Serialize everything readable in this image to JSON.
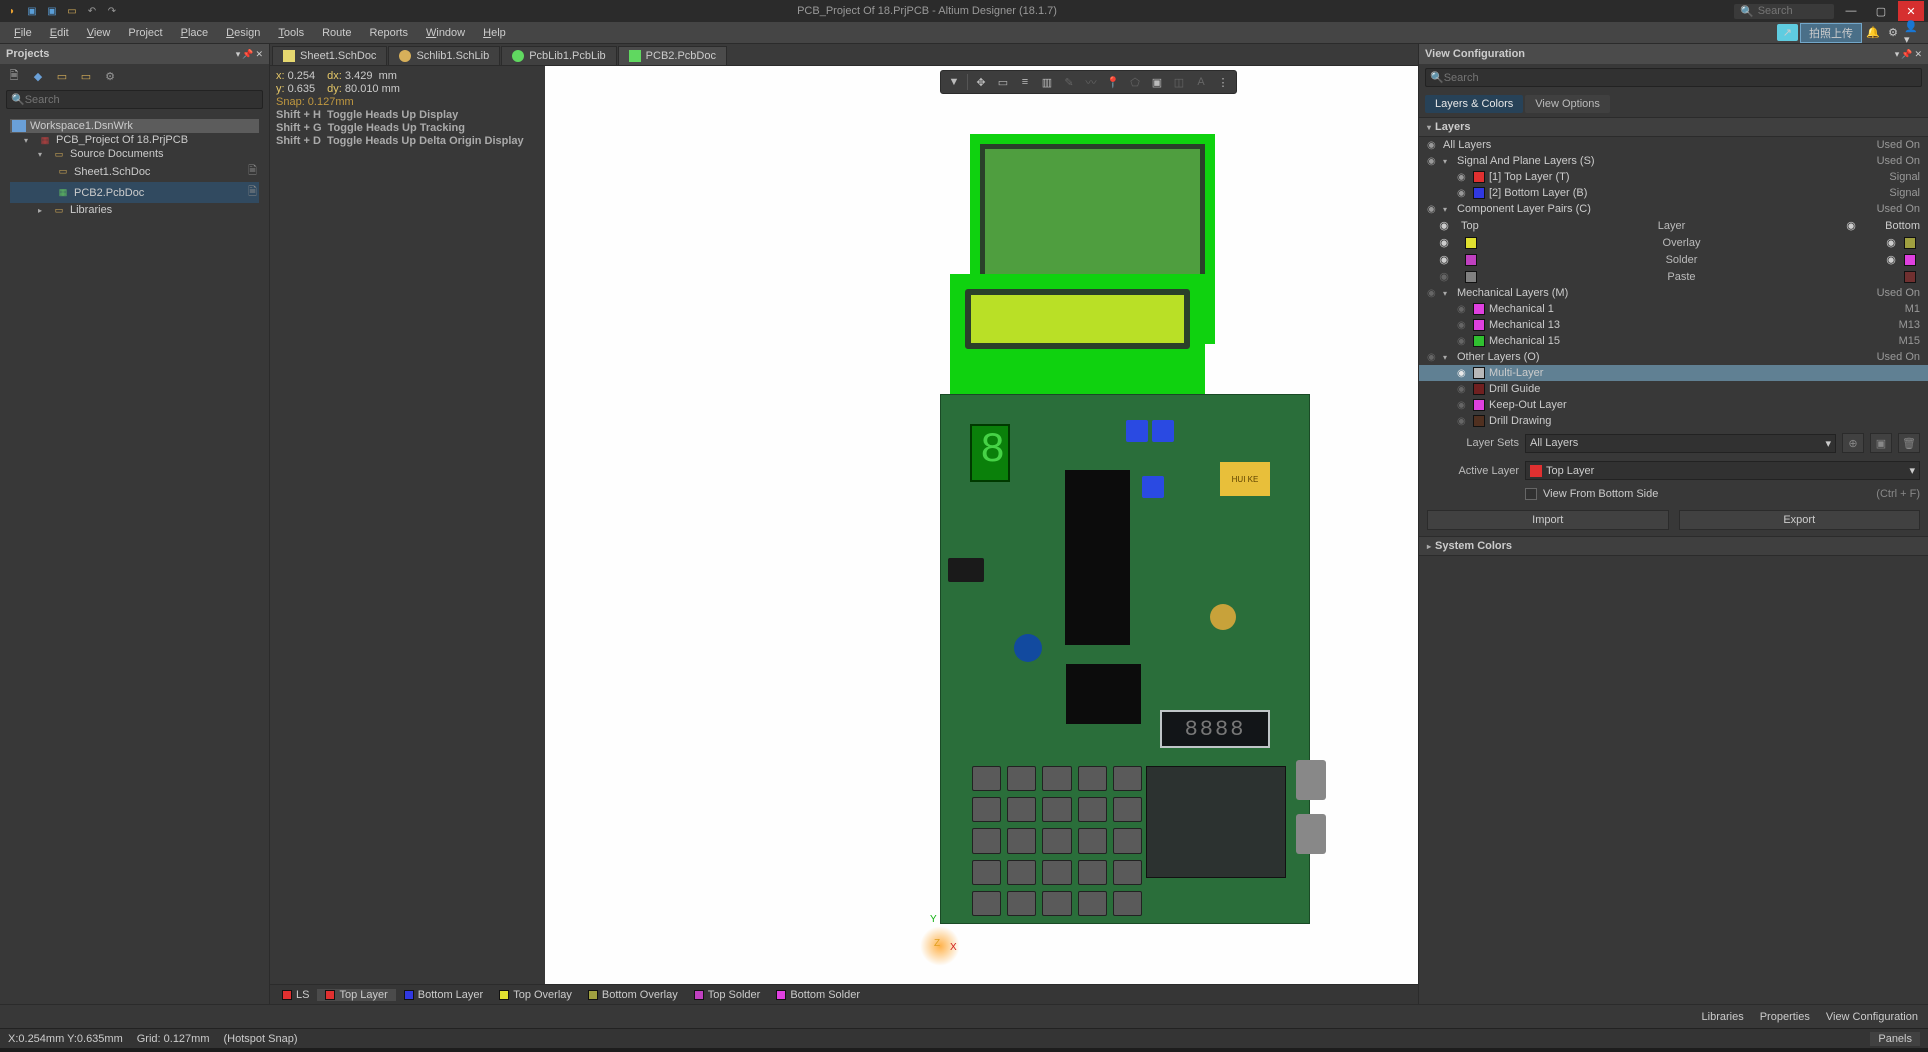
{
  "title": "PCB_Project Of 18.PrjPCB - Altium Designer (18.1.7)",
  "search_placeholder": "Search",
  "upload_btn": "拍照上传",
  "menu": {
    "file": "File",
    "edit": "Edit",
    "view": "View",
    "project": "Project",
    "place": "Place",
    "design": "Design",
    "tools": "Tools",
    "route": "Route",
    "reports": "Reports",
    "window": "Window",
    "help": "Help"
  },
  "projects": {
    "title": "Projects",
    "search_placeholder": "Search",
    "tree": {
      "workspace": "Workspace1.DsnWrk",
      "project": "PCB_Project Of 18.PrjPCB",
      "source_docs": "Source Documents",
      "sheet": "Sheet1.SchDoc",
      "pcb": "PCB2.PcbDoc",
      "libraries": "Libraries"
    }
  },
  "doc_tabs": {
    "t1": "Sheet1.SchDoc",
    "t2": "Schlib1.SchLib",
    "t3": "PcbLib1.PcbLib",
    "t4": "PCB2.PcbDoc"
  },
  "hud": {
    "x_lbl": "x:",
    "x_val": "0.254",
    "dx_lbl": "dx:",
    "dx_val": "3.429",
    "xu": "mm",
    "y_lbl": "y:",
    "y_val": "0.635",
    "dy_lbl": "dy:",
    "dy_val": "80.010",
    "yu": "mm",
    "snap": "Snap: 0.127mm",
    "h1a": "Shift + H",
    "h1b": "Toggle Heads Up Display",
    "h2a": "Shift + G",
    "h2b": "Toggle Heads Up Tracking",
    "h3a": "Shift + D",
    "h3b": "Toggle Heads Up Delta Origin Display"
  },
  "relay_label": "HUI KE",
  "seg4_text": "8888",
  "layer_strip": {
    "ls": "LS",
    "top": "Top Layer",
    "bottom": "Bottom Layer",
    "tov": "Top Overlay",
    "bov": "Bottom Overlay",
    "tsold": "Top Solder",
    "bsold": "Bottom Solder"
  },
  "view_config": {
    "title": "View Configuration",
    "search_placeholder": "Search",
    "tab_layers": "Layers & Colors",
    "tab_view": "View Options",
    "sect_layers": "Layers",
    "all_layers": "All Layers",
    "used_on": "Used On",
    "sig_plane": "Signal And Plane Layers (S)",
    "top_layer": "[1] Top Layer (T)",
    "bottom_layer": "[2] Bottom Layer (B)",
    "signal": "Signal",
    "comp_pairs": "Component Layer Pairs (C)",
    "cp_top": "Top",
    "cp_layer": "Layer",
    "cp_bottom": "Bottom",
    "overlay": "Overlay",
    "solder": "Solder",
    "paste": "Paste",
    "mech": "Mechanical Layers (M)",
    "m1": "Mechanical 1",
    "m1s": "M1",
    "m13": "Mechanical 13",
    "m13s": "M13",
    "m15": "Mechanical 15",
    "m15s": "M15",
    "other": "Other Layers (O)",
    "multi": "Multi-Layer",
    "drillg": "Drill Guide",
    "keepout": "Keep-Out Layer",
    "drilld": "Drill Drawing",
    "layer_sets_lbl": "Layer Sets",
    "layer_sets_val": "All Layers",
    "active_lbl": "Active Layer",
    "active_val": "Top Layer",
    "view_bottom": "View From Bottom Side",
    "view_bottom_hint": "(Ctrl + F)",
    "import": "Import",
    "export": "Export",
    "sys_colors": "System Colors"
  },
  "bottom_links": {
    "lib": "Libraries",
    "prop": "Properties",
    "vc": "View Configuration"
  },
  "status": {
    "xy": "X:0.254mm Y:0.635mm",
    "grid": "Grid: 0.127mm",
    "snap": "(Hotspot Snap)",
    "panels": "Panels"
  }
}
